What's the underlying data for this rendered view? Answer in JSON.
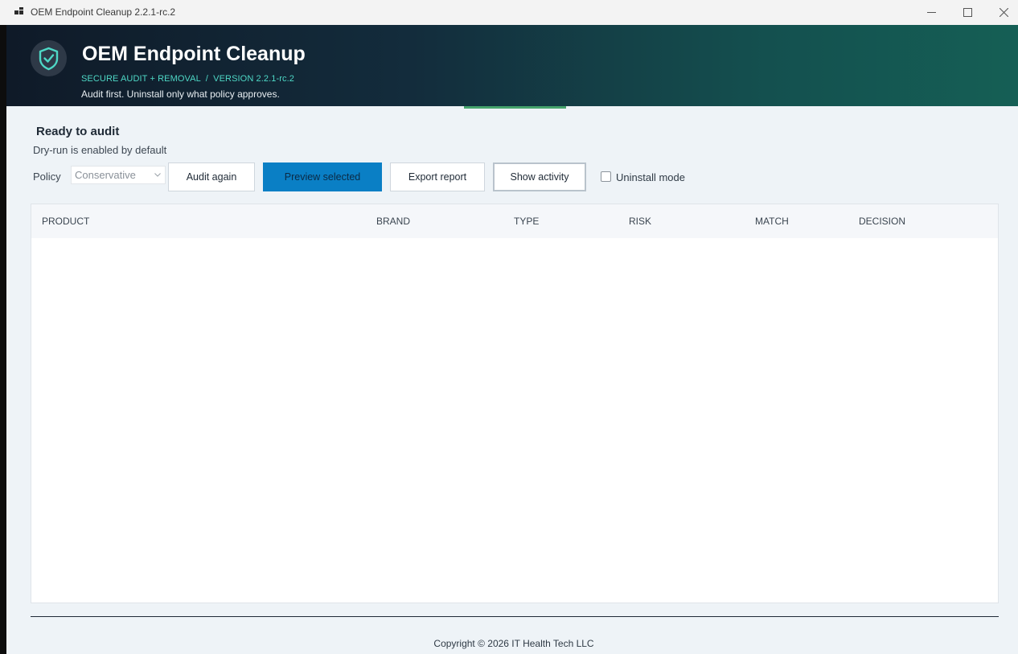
{
  "window": {
    "title": "OEM Endpoint Cleanup 2.2.1-rc.2",
    "controls": {
      "minimize": "minimize-icon",
      "maximize": "maximize-icon",
      "close": "close-icon"
    }
  },
  "header": {
    "app_name": "OEM Endpoint Cleanup",
    "subtitle": "SECURE AUDIT + REMOVAL  /  VERSION 2.2.1-rc.2",
    "tagline": "Audit first. Uninstall only what policy approves.",
    "logo_icon": "shield-check-icon",
    "colors": {
      "accent": "#4ed8c6",
      "header_start": "#0f1a28",
      "header_end": "#155f55"
    }
  },
  "status": {
    "title": "Ready to audit",
    "subtitle": "Dry-run is enabled by default"
  },
  "toolbar": {
    "policy_label": "Policy",
    "policy_value": "Conservative",
    "audit_again": "Audit again",
    "preview_selected": "Preview selected",
    "export_report": "Export report",
    "show_activity": "Show activity",
    "uninstall_mode_label": "Uninstall mode",
    "uninstall_mode_checked": false,
    "colors": {
      "primary": "#0a7fc5"
    }
  },
  "table": {
    "columns": [
      "PRODUCT",
      "BRAND",
      "TYPE",
      "RISK",
      "MATCH",
      "DECISION"
    ],
    "rows": []
  },
  "footer": {
    "copyright": "Copyright © 2026 IT Health Tech LLC"
  }
}
